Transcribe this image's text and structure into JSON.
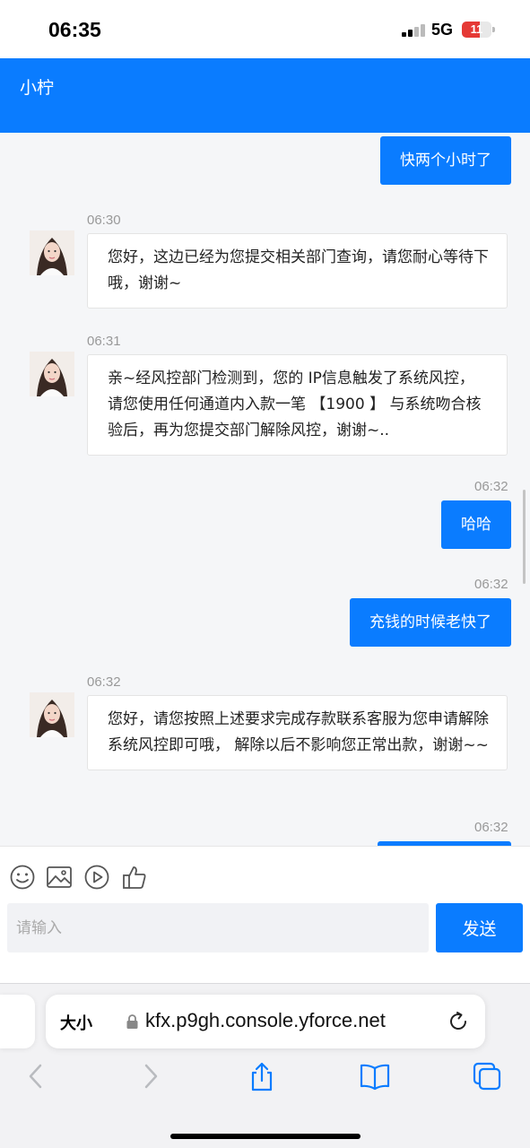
{
  "status_bar": {
    "time": "06:35",
    "network": "5G",
    "battery": "11",
    "battery_level_percent": 11
  },
  "header": {
    "title": "小柠"
  },
  "messages": [
    {
      "direction": "out",
      "text": "快两个小时了"
    },
    {
      "direction": "in",
      "time": "06:30",
      "text": "您好，这边已经为您提交相关部门查询，请您耐心等待下哦，谢谢~"
    },
    {
      "direction": "in",
      "time": "06:31",
      "text": "亲~经风控部门检测到，您的 IP信息触发了系统风控，请您使用任何通道内入款一笔 【1900 】 与系统吻合核验后，再为您提交部门解除风控，谢谢~.."
    },
    {
      "direction": "out",
      "time": "06:32",
      "text": "哈哈"
    },
    {
      "direction": "out",
      "time": "06:32",
      "text": "充钱的时候老快了"
    },
    {
      "direction": "in",
      "time": "06:32",
      "text": "您好，请您按照上述要求完成存款联系客服为您申请解除系统风控即可哦， 解除以后不影响您正常出款，谢谢~~"
    },
    {
      "direction": "out",
      "time": "06:32",
      "text": ""
    }
  ],
  "toolbar": {
    "icons": [
      "emoji-icon",
      "image-icon",
      "video-icon",
      "thumbs-up-icon"
    ]
  },
  "composer": {
    "placeholder": "请输入",
    "value": "",
    "send_label": "发送"
  },
  "browser": {
    "text_size_label": "大小",
    "url": "kfx.p9gh.console.yforce.net"
  },
  "colors": {
    "accent": "#0a7cff",
    "chat_bg": "#f5f6f8",
    "battery_low": "#e53935"
  }
}
